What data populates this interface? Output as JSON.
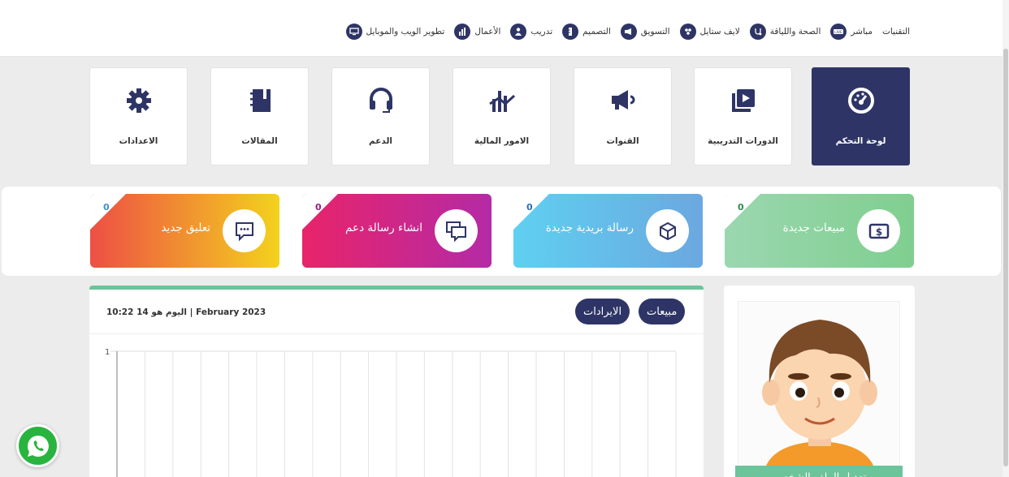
{
  "topnav": [
    {
      "label": "تطوير الويب والموبايل",
      "icon": "monitor-icon"
    },
    {
      "label": "الأعمال",
      "icon": "bar-chart-icon"
    },
    {
      "label": "تدريب",
      "icon": "people-icon"
    },
    {
      "label": "التصميم",
      "icon": "ruler-icon"
    },
    {
      "label": "التسويق",
      "icon": "megaphone-icon"
    },
    {
      "label": "لايف ستايل",
      "icon": "group-icon"
    },
    {
      "label": "الصحة واللياقة",
      "icon": "stethoscope-icon"
    },
    {
      "label": "مباشر",
      "icon": "live-icon"
    },
    {
      "label": "التقنيات",
      "icon": ""
    }
  ],
  "tiles": [
    {
      "label": "لوحة التحكم",
      "icon": "dashboard-gauge-icon",
      "active": true
    },
    {
      "label": "الدورات التدريبية",
      "icon": "video-courses-icon"
    },
    {
      "label": "القنوات",
      "icon": "megaphone-icon"
    },
    {
      "label": "الامور المالية",
      "icon": "finance-chart-icon"
    },
    {
      "label": "الدعم",
      "icon": "headset-icon"
    },
    {
      "label": "المقالات",
      "icon": "notebook-icon"
    },
    {
      "label": "الاعدادات",
      "icon": "gear-icon"
    }
  ],
  "cards": [
    {
      "label": "مبيعات جديدة",
      "count": "0",
      "icon": "money-icon",
      "gradient": [
        "#7fcf8f",
        "#9bd7b0"
      ],
      "countColor": "#2e8b4e"
    },
    {
      "label": "رسالة بريدية جديدة",
      "count": "0",
      "icon": "package-icon",
      "gradient": [
        "#6ba8e0",
        "#5fd0f0"
      ],
      "countColor": "#2b6fb3"
    },
    {
      "label": "انشاء رسالة دعم",
      "count": "0",
      "icon": "chat-bubbles-icon",
      "gradient": [
        "#b42aa6",
        "#e8246a"
      ],
      "countColor": "#9b1d83"
    },
    {
      "label": "تعليق جديد",
      "count": "0",
      "icon": "comment-dots-icon",
      "gradient": [
        "#f3d21d",
        "#ee4f45"
      ],
      "countColor": "#3f8fd8"
    }
  ],
  "panel": {
    "date_text": "اليوم هو 14 10:22 | February 2023",
    "tab_sales": "مبيعات",
    "tab_revenue": "الايرادات"
  },
  "chart_data": {
    "type": "line",
    "y_tick": "1",
    "ylim": [
      0,
      1
    ],
    "grid": true,
    "series": []
  },
  "profile": {
    "button": "تعديل الملف الشخصي"
  },
  "colors": {
    "navy": "#2e3566",
    "green": "#6cc49a",
    "whatsapp": "#29b43f"
  }
}
